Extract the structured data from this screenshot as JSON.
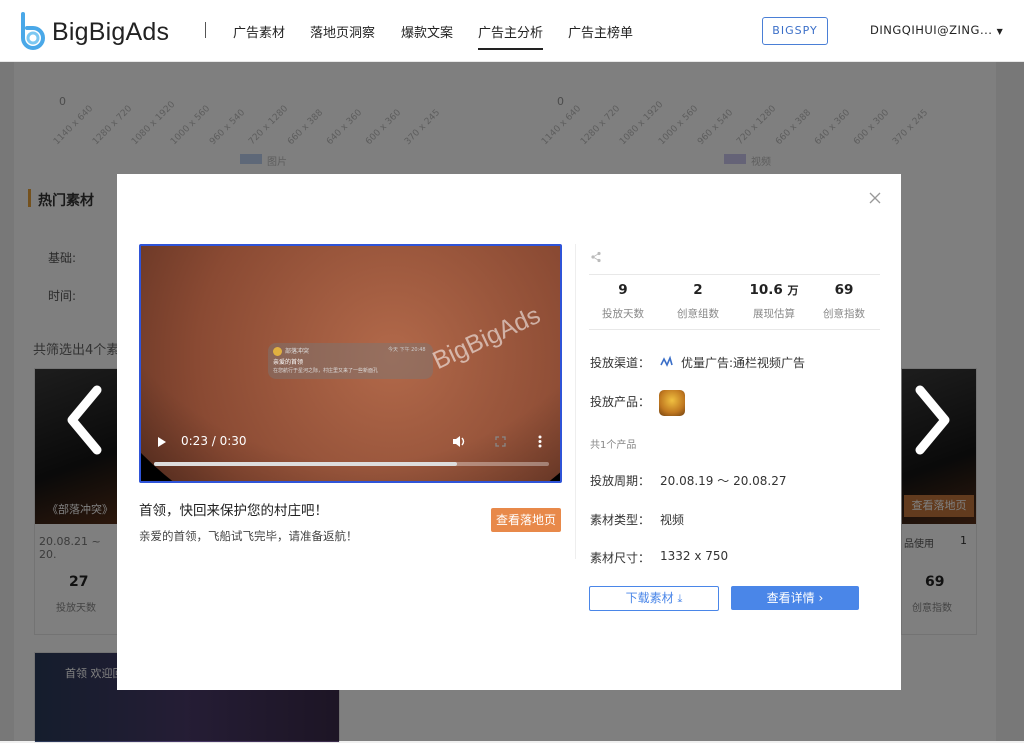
{
  "brand": {
    "name": "BigBigAds"
  },
  "nav": {
    "items": [
      {
        "label": "广告素材"
      },
      {
        "label": "落地页洞察"
      },
      {
        "label": "爆款文案"
      },
      {
        "label": "广告主分析",
        "active": true
      },
      {
        "label": "广告主榜单"
      }
    ],
    "bigspy_label": "BIGSPY",
    "user": "DINGQIHUI@ZING..."
  },
  "background": {
    "chart_ticks_left": [
      "1140 x 640",
      "1280 x 720",
      "1080 x 1920",
      "1000 x 560",
      "960 x 540",
      "720 x 1280",
      "660 x 388",
      "640 x 360",
      "600 x 360",
      "370 x 245"
    ],
    "chart_ticks_right": [
      "1140 x 640",
      "1280 x 720",
      "1080 x 1920",
      "1000 x 560",
      "960 x 540",
      "720 x 1280",
      "660 x 388",
      "640 x 360",
      "600 x 300",
      "370 x 245"
    ],
    "zero": "0",
    "legend_left": "图片",
    "legend_right": "视频",
    "section_title": "热门素材",
    "filter_basic": "基础:",
    "filter_time": "时间:",
    "result_text": "共筛选出4个素",
    "card1_title": "《部落冲突》",
    "card1_date": "20.08.21 ~ 20.",
    "card1_days": "27",
    "card1_days_label": "投放天数",
    "card_right_index": "69",
    "card_right_index_label": "创意指数",
    "card_right_landing": "查看落地页",
    "card_right_usage": "品使用",
    "card_right_usage_count": "1",
    "card2_banner": "首领 欢迎回"
  },
  "modal": {
    "video": {
      "time": "0:23 / 0:30",
      "progress": 0.767,
      "watermark": "BigBigAds",
      "notif_app": "部落冲突",
      "notif_time": "今天 下午 20:48",
      "notif_title": "亲爱的首领",
      "notif_body": "在您航行于星河之际，村庄里又来了一些新面孔"
    },
    "title": "首领，快回来保护您的村庄吧！",
    "description": "亲爱的首领，飞船试飞完毕，请准备返航！",
    "landing_button": "查看落地页",
    "stats": [
      {
        "value": "9",
        "unit": "",
        "label": "投放天数"
      },
      {
        "value": "2",
        "unit": "",
        "label": "创意组数"
      },
      {
        "value": "10.6",
        "unit": "万",
        "label": "展现估算"
      },
      {
        "value": "69",
        "unit": "",
        "label": "创意指数"
      }
    ],
    "channel_label": "投放渠道：",
    "channel_value": "优量广告:通栏视频广告",
    "product_label": "投放产品：",
    "product_count": "共1个产品",
    "period_label": "投放周期：",
    "period_value": "20.08.19 ～ 20.08.27",
    "type_label": "素材类型：",
    "type_value": "视频",
    "size_label": "素材尺寸：",
    "size_value": "1332 x 750",
    "download_button": "下载素材",
    "detail_button": "查看详情"
  }
}
